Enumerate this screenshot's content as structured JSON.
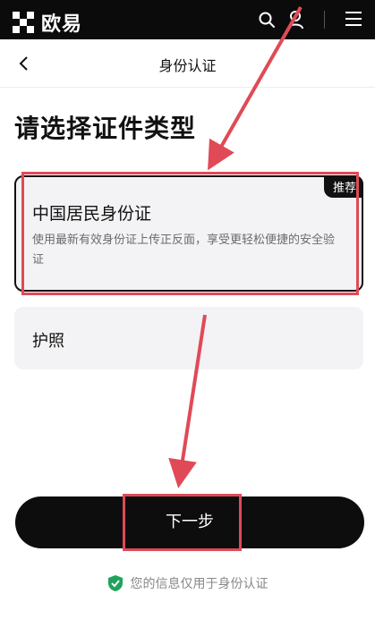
{
  "header": {
    "brand_name": "欧易",
    "icons": [
      "search-icon",
      "user-icon",
      "menu-icon"
    ]
  },
  "nav": {
    "back_icon": "chevron-left-icon",
    "title": "身份认证"
  },
  "main": {
    "title": "请选择证件类型",
    "options": [
      {
        "title": "中国居民身份证",
        "description": "使用最新有效身份证上传正反面，享受更轻松便捷的安全验证",
        "badge": "推荐",
        "selected": true
      },
      {
        "title": "护照",
        "selected": false
      }
    ]
  },
  "footer": {
    "next_label": "下一步",
    "privacy_note": "您的信息仅用于身份认证",
    "privacy_icon": "shield-check-icon"
  },
  "colors": {
    "topbar": "#0b0b0b",
    "card_bg": "#f3f3f5",
    "button_bg": "#0d0d0d",
    "annotation": "#e04a57",
    "shield": "#1fa35b"
  }
}
